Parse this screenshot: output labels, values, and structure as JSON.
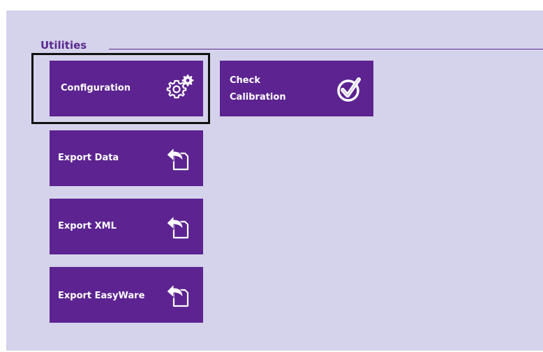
{
  "utilities": {
    "section_title": "Utilities",
    "tiles": {
      "configuration": {
        "label": "Configuration",
        "icon": "gears-icon",
        "selected": true
      },
      "check_calibration": {
        "label_line1": "Check",
        "label_line2": "Calibration",
        "icon": "check-circle-icon"
      },
      "export_data": {
        "label": "Export Data",
        "icon": "export-icon"
      },
      "export_xml": {
        "label": "Export XML",
        "icon": "export-icon"
      },
      "export_easyware": {
        "label": "Export EasyWare",
        "icon": "export-icon"
      }
    }
  },
  "colors": {
    "background": "#d4d3eb",
    "tile": "#5c2391",
    "accent": "#5b2a8e",
    "selection": "#111111"
  }
}
